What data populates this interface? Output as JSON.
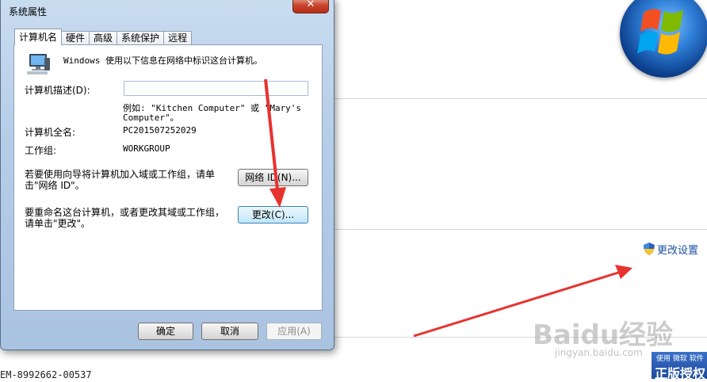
{
  "background": {
    "product_id": "EM-8992662-00537",
    "change_settings_label": "更改设置",
    "genuine_badge": {
      "top": "使用 微软 软件",
      "main": "正版授权"
    },
    "watermark": {
      "main": "Baidu经验",
      "sub": "jingyan.baidu.com"
    }
  },
  "dialog": {
    "title": "系统属性",
    "close_label": "✕",
    "tabs": [
      "计算机名",
      "硬件",
      "高级",
      "系统保护",
      "远程"
    ],
    "active_tab": 0,
    "intro": "Windows 使用以下信息在网络中标识这台计算机。",
    "description_label": "计算机描述(D):",
    "description_value": "",
    "example_line1": "例如: \"Kitchen Computer\" 或 \"Mary's",
    "example_line2": "Computer\"。",
    "full_name_label": "计算机全名:",
    "full_name_value": "PC201507252029",
    "workgroup_label": "工作组:",
    "workgroup_value": "WORKGROUP",
    "network_text_line1": "若要使用向导将计算机加入域或工作组，请单",
    "network_text_line2": "击\"网络 ID\"。",
    "network_id_button": "网络 ID(N)...",
    "rename_text_line1": "要重命名这台计算机，或者更改其域或工作组，",
    "rename_text_line2": "请单击\"更改\"。",
    "change_button": "更改(C)...",
    "ok_button": "确定",
    "cancel_button": "取消",
    "apply_button": "应用(A)"
  },
  "colors": {
    "annotation_arrow": "#e8322f",
    "link": "#1a52a0",
    "dialog_frame": "#b6cde8"
  }
}
